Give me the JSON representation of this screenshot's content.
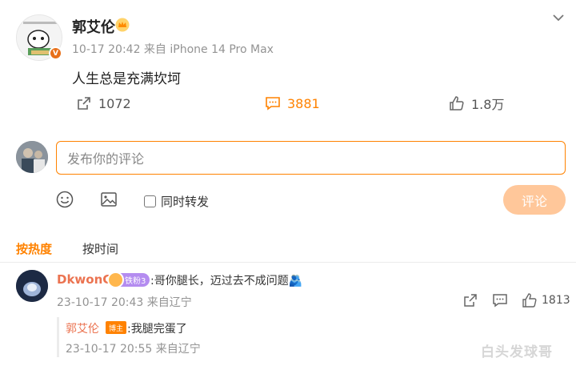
{
  "post": {
    "author": "郭艾伦",
    "meta": "10-17 20:42  来自 iPhone 14 Pro Max",
    "content": "人生总是充满坎坷",
    "reposts": "1072",
    "comments": "3881",
    "likes": "1.8万"
  },
  "composer": {
    "placeholder": "发布你的评论",
    "repost_label": "同时转发",
    "submit_label": "评论"
  },
  "sort": {
    "hot": "按热度",
    "time": "按时间"
  },
  "comments": [
    {
      "user": "DkwonC",
      "fan_badge": "铁粉3",
      "text": ":哥你腿长，迈过去不成问题🫂",
      "time": "23-10-17 20:43 来自辽宁",
      "likes": "1813",
      "reply": {
        "user": "郭艾伦",
        "badge": "博主",
        "text": ":我腿完蛋了",
        "time": "23-10-17 20:55 来自辽宁"
      }
    }
  ],
  "watermark": "白头发球哥",
  "colors": {
    "accent": "#ff8200",
    "username": "#eb7350",
    "muted": "#939393"
  }
}
